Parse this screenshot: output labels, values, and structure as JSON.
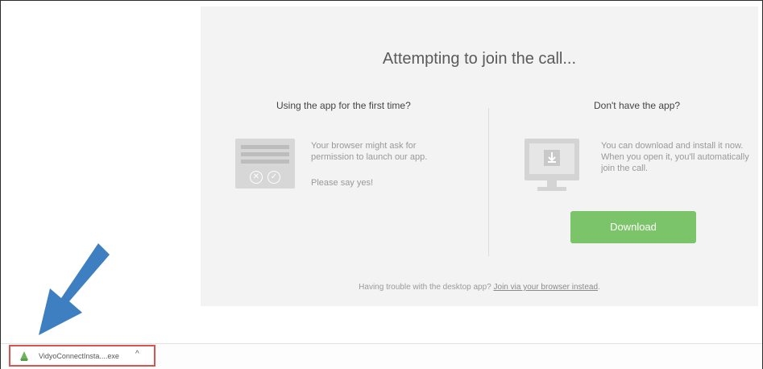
{
  "page": {
    "title": "Attempting to join the call...",
    "first_time": {
      "heading": "Using the app for the first time?",
      "description": "Your browser might ask for permission to launch our app.",
      "note": "Please say yes!"
    },
    "no_app": {
      "heading": "Don't have the app?",
      "description": "You can download and install it now. When you open it, you'll automatically join the call.",
      "button_label": "Download"
    },
    "trouble_text": "Having trouble with the desktop app?",
    "browser_link": "Join via your browser instead",
    "trouble_end": "."
  },
  "download_bar": {
    "filename": "VidyoConnectInsta....exe",
    "chevron": "^"
  },
  "colors": {
    "panel": "#f3f3f3",
    "button": "#7cc46a",
    "arrow": "#3d7fc0",
    "highlight": "#d9534f"
  },
  "icons": [
    "browser-permission-icon",
    "monitor-download-icon",
    "file-icon",
    "chevron-up-icon",
    "arrow-annotation"
  ]
}
